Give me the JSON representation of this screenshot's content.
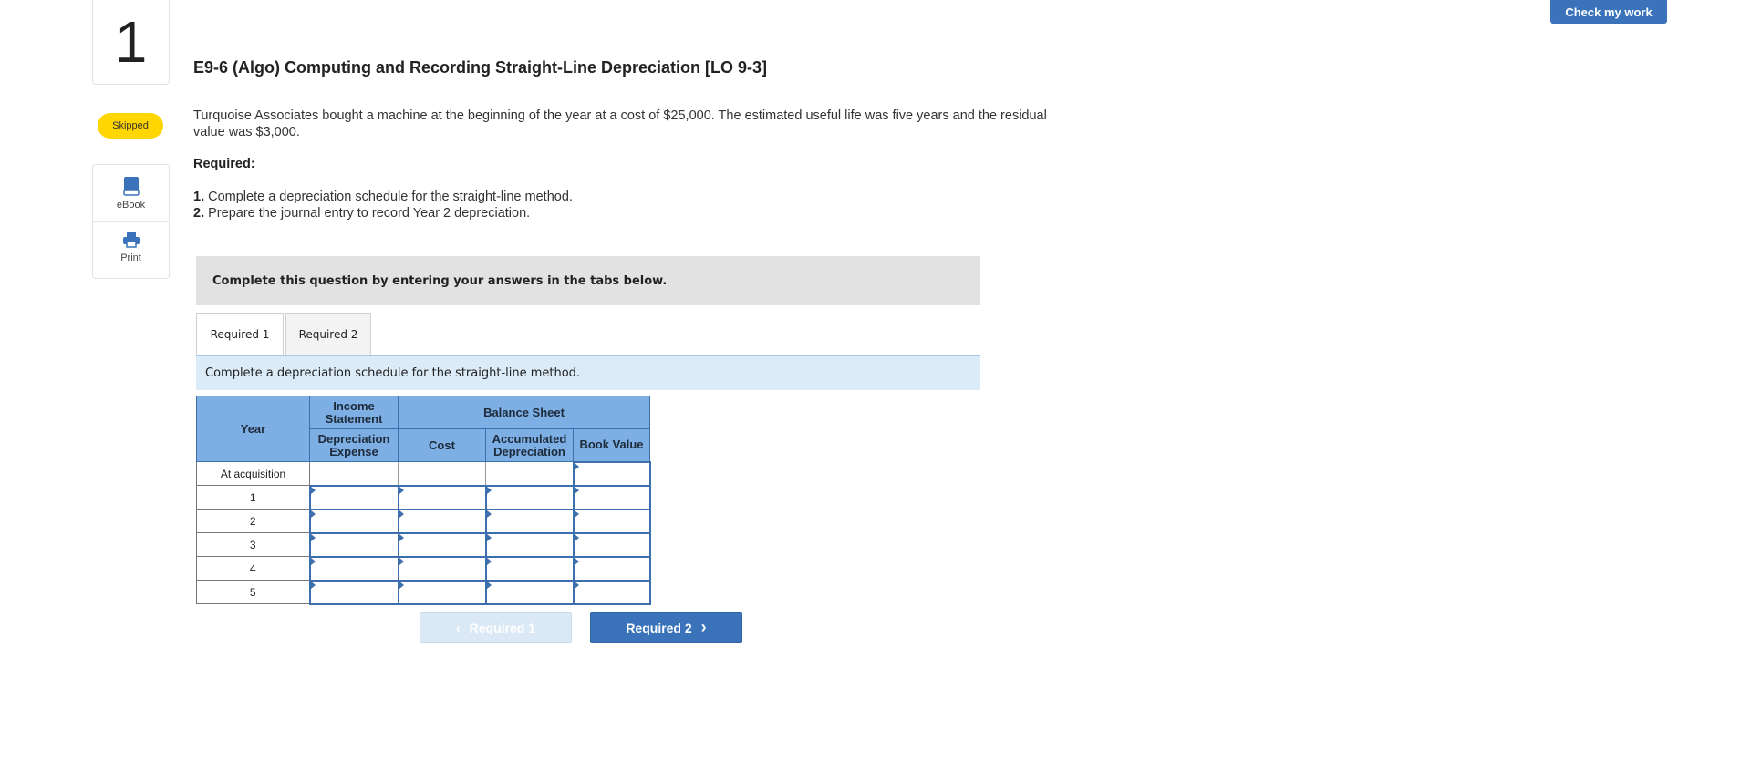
{
  "question_number": "1",
  "status_badge": "Skipped",
  "tools": {
    "ebook": "eBook",
    "print": "Print"
  },
  "check_button": "Check my work",
  "title": "E9-6 (Algo) Computing and Recording Straight-Line Depreciation [LO 9-3]",
  "intro": "Turquoise Associates bought a machine at the beginning of the year at a cost of $25,000. The estimated useful life was five years and the residual value was $3,000.",
  "required_heading": "Required:",
  "requirements": [
    {
      "num": "1.",
      "text": "Complete a depreciation schedule for the straight-line method."
    },
    {
      "num": "2.",
      "text": "Prepare the journal entry to record Year 2 depreciation."
    }
  ],
  "instruction": "Complete this question by entering your answers in the tabs below.",
  "tabs": [
    {
      "label": "Required 1",
      "active": true
    },
    {
      "label": "Required 2",
      "active": false
    }
  ],
  "sub_instruction": "Complete a depreciation schedule for the straight-line method.",
  "table": {
    "col_year": "Year",
    "group_income": "Income Statement",
    "group_balance": "Balance Sheet",
    "col_dep_expense": "Depreciation Expense",
    "col_cost": "Cost",
    "col_accum_dep": "Accumulated Depreciation",
    "col_book_value": "Book Value",
    "rows": [
      "At acquisition",
      "1",
      "2",
      "3",
      "4",
      "5"
    ]
  },
  "nav": {
    "prev": "Required 1",
    "next": "Required 2"
  },
  "colors": {
    "accent": "#3a73b9",
    "badge": "#ffd600",
    "header_fill": "#7daee4"
  }
}
